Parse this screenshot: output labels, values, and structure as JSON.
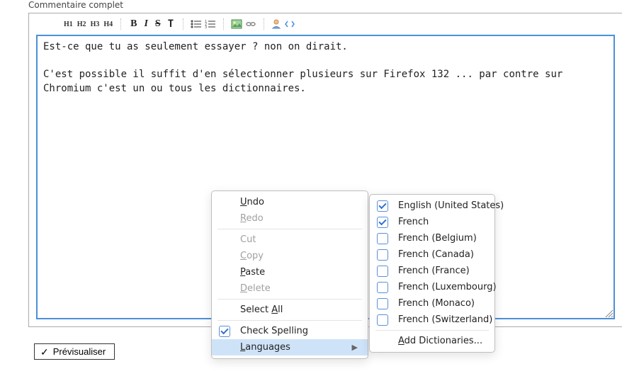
{
  "section_label": "Commentaire complet",
  "toolbar": {
    "h1": "H1",
    "h2": "H2",
    "h3": "H3",
    "h4": "H4",
    "bold": "B",
    "italic": "I",
    "strike": "S",
    "tt": "T"
  },
  "editor_text": "Est-ce que tu as seulement essayer ? non on dirait.\n\nC'est possible il suffit d'en sélectionner plusieurs sur Firefox 132 ... par contre sur Chromium c'est un ou tous les dictionnaires.",
  "preview_label": "Prévisualiser",
  "context_menu": {
    "undo": "ndo",
    "undo_mn": "U",
    "redo": "edo",
    "redo_mn": "R",
    "cut": "t",
    "cut_mn": "Cu",
    "copy": "opy",
    "copy_mn": "C",
    "paste": "aste",
    "paste_mn": "P",
    "delete": "elete",
    "delete_mn": "D",
    "select_all_pre": "Select ",
    "select_all_mn": "A",
    "select_all_post": "ll",
    "check_spelling": "Check Spelling",
    "languages": "anguages",
    "languages_mn": "L"
  },
  "lang_menu": {
    "items": [
      {
        "label": "English (United States)",
        "checked": true
      },
      {
        "label": "French",
        "checked": true
      },
      {
        "label": "French (Belgium)",
        "checked": false
      },
      {
        "label": "French (Canada)",
        "checked": false
      },
      {
        "label": "French (France)",
        "checked": false
      },
      {
        "label": "French (Luxembourg)",
        "checked": false
      },
      {
        "label": "French (Monaco)",
        "checked": false
      },
      {
        "label": "French (Switzerland)",
        "checked": false
      }
    ],
    "add_pre": "",
    "add_mn": "A",
    "add_post": "dd Dictionaries..."
  }
}
